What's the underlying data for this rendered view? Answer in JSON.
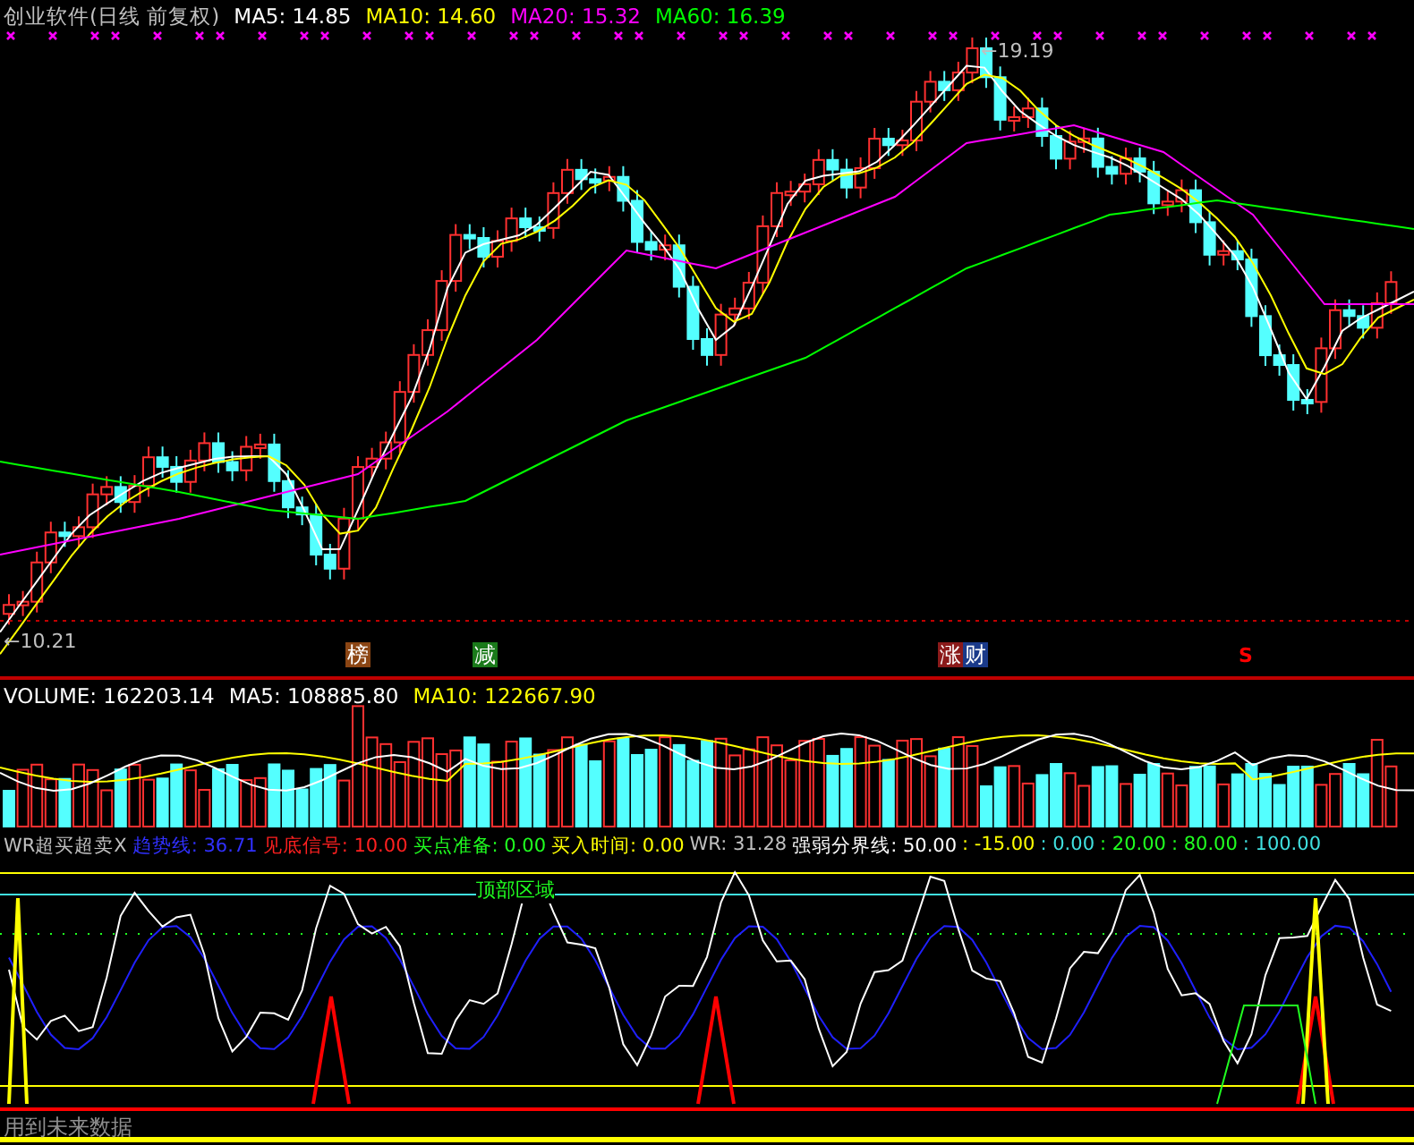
{
  "price_panel": {
    "title": "创业软件(日线 前复权)",
    "indicators": [
      {
        "label": "MA5: 14.85",
        "color": "#ffffff"
      },
      {
        "label": "MA10: 14.60",
        "color": "#ffff00"
      },
      {
        "label": "MA20: 15.32",
        "color": "#ff00ff"
      },
      {
        "label": "MA60: 16.39",
        "color": "#00ff00"
      }
    ],
    "high_label": "←19.19",
    "low_label": "←10.21",
    "signal_tags": [
      {
        "kind": "tag",
        "text": "榜",
        "color": "#8b4513"
      },
      {
        "kind": "tag",
        "text": "减",
        "color": "#1a7a1a"
      },
      {
        "kind": "tag",
        "text": "涨",
        "color": "#8b1a1a"
      },
      {
        "kind": "tag",
        "text": "财",
        "color": "#1a3a8a"
      },
      {
        "kind": "mark",
        "text": "S",
        "color": "#ff0000"
      }
    ]
  },
  "volume_panel": {
    "indicators": [
      {
        "label": "VOLUME: 162203.14",
        "color": "#ffffff"
      },
      {
        "label": "MA5: 108885.80",
        "color": "#ffffff"
      },
      {
        "label": "MA10: 122667.90",
        "color": "#ffff00"
      }
    ]
  },
  "wr_panel": {
    "indicators": [
      {
        "label": "WR超买超卖X",
        "color": "#c0c0c0"
      },
      {
        "label": "趋势线: 36.71",
        "color": "#3030ff"
      },
      {
        "label": "见底信号: 10.00",
        "color": "#ff2020"
      },
      {
        "label": "买点准备: 0.00",
        "color": "#20ff20"
      },
      {
        "label": "买入时间: 0.00",
        "color": "#ffff00"
      },
      {
        "label": "WR: 31.28",
        "color": "#c0c0c0"
      },
      {
        "label": "强弱分界线: 50.00",
        "color": "#ffffff"
      },
      {
        "label": ": -15.00",
        "color": "#ffff00"
      },
      {
        "label": ": 0.00",
        "color": "#40e0e0"
      },
      {
        "label": ": 20.00",
        "color": "#20ff20"
      },
      {
        "label": ": 80.00",
        "color": "#20ff20"
      },
      {
        "label": ": 100.00",
        "color": "#40e0e0"
      }
    ],
    "zone_label": "顶部区域",
    "warning": "用到未来数据"
  }
}
